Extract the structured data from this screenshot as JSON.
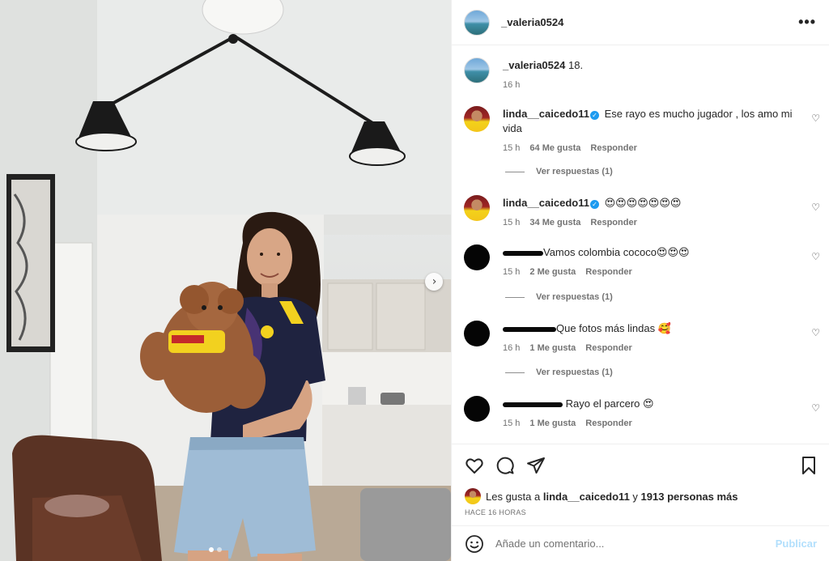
{
  "post": {
    "author": "_valeria0524",
    "more_label": "•••",
    "caption": "18.",
    "caption_time": "16 h"
  },
  "photo": {
    "carousel_next": "›"
  },
  "comments": [
    {
      "user": "linda__caicedo11",
      "verified": true,
      "text": "Ese rayo es mucho jugador , los amo mi vida",
      "time": "15 h",
      "likes": "64 Me gusta",
      "reply": "Responder",
      "view_replies": "Ver respuestas (1)"
    },
    {
      "user": "linda__caicedo11",
      "verified": true,
      "text": "😍😍😍😍😍😍😍",
      "time": "15 h",
      "likes": "34 Me gusta",
      "reply": "Responder"
    },
    {
      "user": "",
      "text": "Vamos colombia cococo😍😍😍",
      "time": "15 h",
      "likes": "2 Me gusta",
      "reply": "Responder",
      "view_replies": "Ver respuestas (1)"
    },
    {
      "user": "",
      "text": "Que fotos más lindas 🥰",
      "time": "16 h",
      "likes": "1 Me gusta",
      "reply": "Responder",
      "view_replies": "Ver respuestas (1)"
    },
    {
      "user": "",
      "text": "Rayo el parcero 😍",
      "time": "15 h",
      "likes": "1 Me gusta",
      "reply": "Responder"
    }
  ],
  "likes_summary": {
    "prefix": "Les gusta a",
    "user": "linda__caicedo11",
    "joiner": "y",
    "others": "1913 personas más"
  },
  "time_ago": "HACE 16 HORAS",
  "composer": {
    "placeholder": "Añade un comentario...",
    "publish": "Publicar"
  },
  "colors": {
    "accent_verified": "#1d9bf0",
    "publish_disabled": "#b2dffc",
    "meta_grey": "#737373"
  },
  "icons": [
    "more-options-icon",
    "heart-icon",
    "comment-icon",
    "share-icon",
    "bookmark-icon",
    "emoji-icon",
    "chevron-right-icon",
    "verified-badge-icon"
  ]
}
